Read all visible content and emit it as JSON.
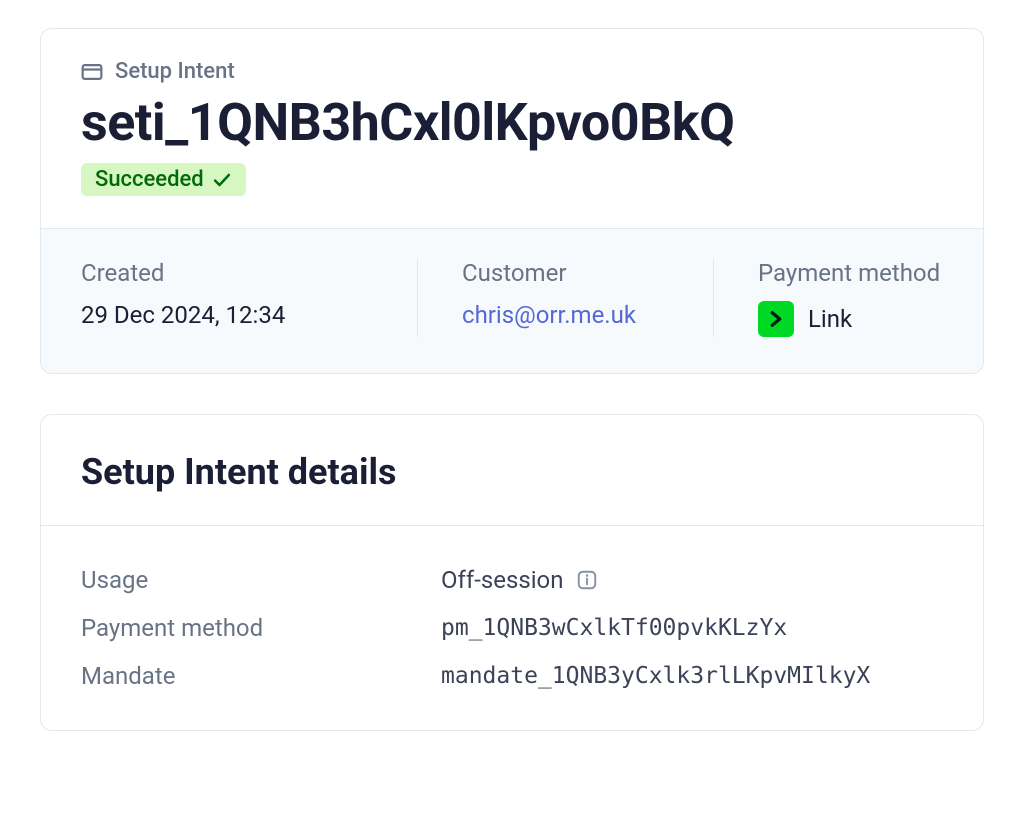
{
  "header": {
    "eyebrow": "Setup Intent",
    "id": "seti_1QNB3hCxl0lKpvo0BkQ",
    "status_label": "Succeeded"
  },
  "summary": {
    "created": {
      "label": "Created",
      "value": "29 Dec 2024, 12:34"
    },
    "customer": {
      "label": "Customer",
      "value": "chris@orr.me.uk"
    },
    "payment_method": {
      "label": "Payment method",
      "value": "Link"
    }
  },
  "details": {
    "section_title": "Setup Intent details",
    "rows": {
      "usage": {
        "label": "Usage",
        "value": "Off-session"
      },
      "payment_method": {
        "label": "Payment method",
        "value": "pm_1QNB3wCxlkTf00pvkKLzYx"
      },
      "mandate": {
        "label": "Mandate",
        "value": "mandate_1QNB3yCxlk3rlLKpvMIlkyX"
      }
    }
  }
}
